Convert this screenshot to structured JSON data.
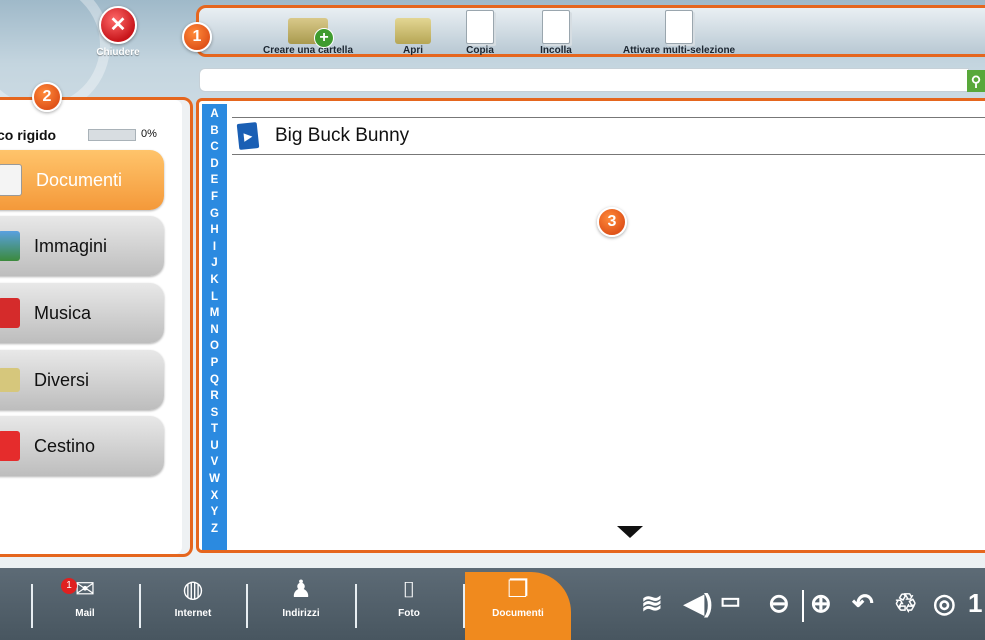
{
  "header": {
    "close_label": "Chiudere"
  },
  "toolbar": {
    "badge": "1",
    "buttons": [
      {
        "label": "Creare una cartella",
        "icon": "new-folder-icon"
      },
      {
        "label": "Apri",
        "icon": "open-folder-icon"
      },
      {
        "label": "Copia",
        "icon": "copy-icon"
      },
      {
        "label": "Incolla",
        "icon": "paste-icon"
      },
      {
        "label": "Attivare multi-selezione",
        "icon": "multi-select-icon"
      }
    ]
  },
  "search": {
    "value": "",
    "icon": "search-icon"
  },
  "sidebar": {
    "badge": "2",
    "disk_label": "co rigido",
    "disk_percent": "0%",
    "disk_fill": 0,
    "categories": [
      {
        "label": "Documenti",
        "icon": "documents-icon",
        "active": true
      },
      {
        "label": "Immagini",
        "icon": "images-icon"
      },
      {
        "label": "Musica",
        "icon": "music-icon"
      },
      {
        "label": "Diversi",
        "icon": "misc-icon"
      },
      {
        "label": "Cestino",
        "icon": "trash-icon"
      }
    ]
  },
  "content": {
    "badge": "3",
    "alphabet": [
      "A",
      "B",
      "C",
      "D",
      "E",
      "F",
      "G",
      "H",
      "I",
      "J",
      "K",
      "L",
      "M",
      "N",
      "O",
      "P",
      "Q",
      "R",
      "S",
      "T",
      "U",
      "V",
      "W",
      "X",
      "Y",
      "Z"
    ],
    "files": [
      {
        "name": "Big Buck Bunny",
        "icon": "video-file-icon"
      }
    ]
  },
  "taskbar": {
    "items": [
      {
        "label": "Mail",
        "icon": "mail-icon",
        "notification": "1"
      },
      {
        "label": "Internet",
        "icon": "globe-icon"
      },
      {
        "label": "Indirizzi",
        "icon": "contacts-icon"
      },
      {
        "label": "Foto",
        "icon": "camera-icon"
      },
      {
        "label": "Documenti",
        "icon": "documents-icon",
        "active": true
      }
    ],
    "system_icons": [
      "wifi-icon",
      "volume-icon",
      "battery-charging-icon",
      "zoom-out-icon",
      "zoom-in-icon",
      "back-icon",
      "trash-icon",
      "help-icon"
    ],
    "system_trailing": "1"
  },
  "colors": {
    "accent": "#e5661e",
    "active_tab": "#f08a1e",
    "alphabet_bar": "#2b8ae0",
    "taskbar": "#56636d"
  }
}
